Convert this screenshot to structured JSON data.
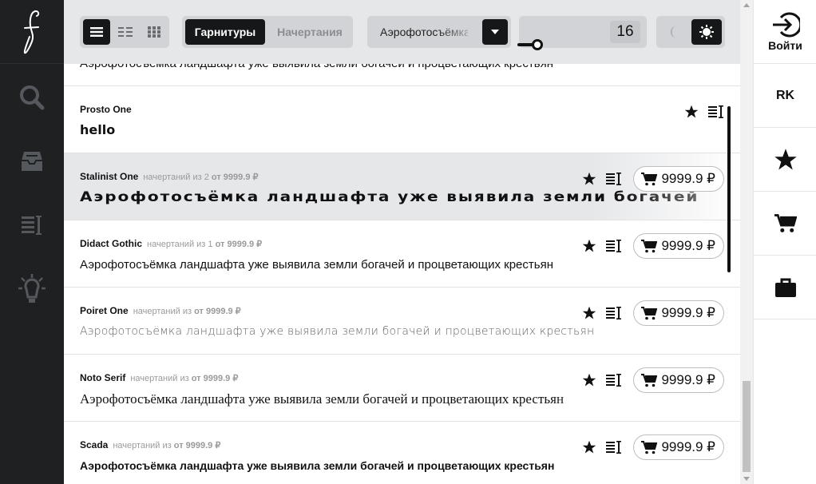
{
  "toolbar": {
    "tabs": [
      "Гарнитуры",
      "Начертания"
    ],
    "sample_text": "Аэрофотосъёмка ла",
    "font_size": "16"
  },
  "auth": {
    "login_label": "Войти"
  },
  "lang": "RK",
  "rows": [
    {
      "name": "",
      "meta_prefix": "",
      "meta_suffix": "",
      "sample": "Аэрофотосъёмка ландшафта уже выявила земли богачей и процветающих крестьян",
      "price": ""
    },
    {
      "name": "Prosto One",
      "meta_prefix": "",
      "meta_suffix": "",
      "sample": "hello",
      "price": ""
    },
    {
      "name": "Stalinist One",
      "meta_prefix": "начертаний  из 2",
      "meta_suffix": "от 9999.9 ₽",
      "sample": "Аэрофотосъёмка ландшафта уже выявила земли богачей",
      "price": "9999.9 ₽"
    },
    {
      "name": "Didact Gothic",
      "meta_prefix": "начертаний  из 1",
      "meta_suffix": "от 9999.9 ₽",
      "sample": "Аэрофотосъёмка ландшафта уже выявила земли богачей и процветающих крестьян",
      "price": "9999.9 ₽"
    },
    {
      "name": "Poiret One",
      "meta_prefix": "начертаний  из",
      "meta_suffix": "от 9999.9 ₽",
      "sample": "Аэрофотосъёмка ландшафта уже выявила земли богачей и процветающих крестьян",
      "price": "9999.9 ₽"
    },
    {
      "name": "Noto Serif",
      "meta_prefix": "начертаний  из",
      "meta_suffix": "от 9999.9 ₽",
      "sample": "Аэрофотосъёмка ландшафта уже выявила земли богачей и процветающих крестьян",
      "price": "9999.9 ₽"
    },
    {
      "name": "Scada",
      "meta_prefix": "начертаний  из",
      "meta_suffix": "от 9999.9 ₽",
      "sample": "Аэрофотосъёмка ландшафта уже выявила земли богачей и процветающих крестьян",
      "price": "9999.9 ₽"
    }
  ],
  "icons": {
    "logo": "calligraphy-f-logo",
    "nav": [
      "search-icon",
      "inbox-icon",
      "text-lines-icon",
      "lightbulb-icon"
    ],
    "right": [
      "login-icon",
      "star-icon",
      "cart-icon",
      "briefcase-icon"
    ]
  },
  "colors": {
    "sidebar": "#1e2022",
    "toolbar": "#e6e7e9",
    "active": "#161718"
  }
}
